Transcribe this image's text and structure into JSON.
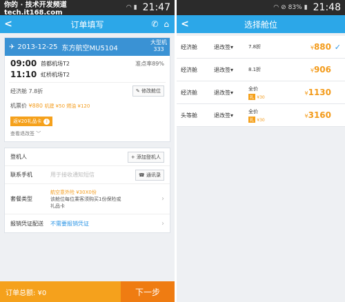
{
  "colors": {
    "accent": "#2ca7e8",
    "price": "#f39b1b",
    "bottom_total": "#f5a11c",
    "bottom_next": "#ef7c12",
    "flight_bar": "#3a92d4"
  },
  "left": {
    "statusbar": {
      "watermark": "你的 · 技术开发频道  tech.it168.com",
      "time": "21:47"
    },
    "header": {
      "title": "订单填写"
    },
    "flight": {
      "date": "2013-12-25",
      "airline": "东方航空MU5104",
      "plane_type": "大型机",
      "plane_model": "333",
      "depart_time": "09:00",
      "depart_airport": "首都机场T2",
      "ontime_label": "准点率89%",
      "arrive_time": "11:10",
      "arrive_airport": "虹桥机场T2"
    },
    "cabin": {
      "label": "经济舱 7.8折",
      "modify_btn": "修改舱位"
    },
    "price_line": {
      "label": "机票价",
      "price": "¥880",
      "fee": "机建 ¥50 燃油 ¥120"
    },
    "coupon": {
      "text": "返¥20礼品卡",
      "info": "i"
    },
    "refund_link": "查看退改签",
    "passenger": {
      "label": "登机人",
      "add_btn": "添加登机人"
    },
    "contact": {
      "label": "联系手机",
      "placeholder": "用于接收通知短信",
      "book_btn": "通讯录"
    },
    "package": {
      "label": "套餐类型",
      "line1": "航空意外险 ¥30X0份",
      "line2": "该舱位每位乘客须购买1份保险或",
      "line3": "礼品卡"
    },
    "invoice": {
      "label": "报销凭证配送",
      "value": "不需要报销凭证"
    },
    "bottom": {
      "total": "订单总额: ¥0",
      "next": "下一步"
    }
  },
  "right": {
    "statusbar": {
      "battery": "83%",
      "time": "21:48"
    },
    "header": {
      "title": "选择舱位"
    },
    "seats": [
      {
        "cls": "经济舱",
        "rule": "退改签",
        "disc": "7.8折",
        "gift": "",
        "price": "880",
        "selected": true
      },
      {
        "cls": "经济舱",
        "rule": "退改签",
        "disc": "8.1折",
        "gift": "",
        "price": "906",
        "selected": false
      },
      {
        "cls": "经济舱",
        "rule": "退改签",
        "disc": "全价",
        "gift": "¥30",
        "price": "1130",
        "selected": false
      },
      {
        "cls": "头等舱",
        "rule": "退改签",
        "disc": "全价",
        "gift": "¥30",
        "price": "3160",
        "selected": false
      }
    ]
  }
}
